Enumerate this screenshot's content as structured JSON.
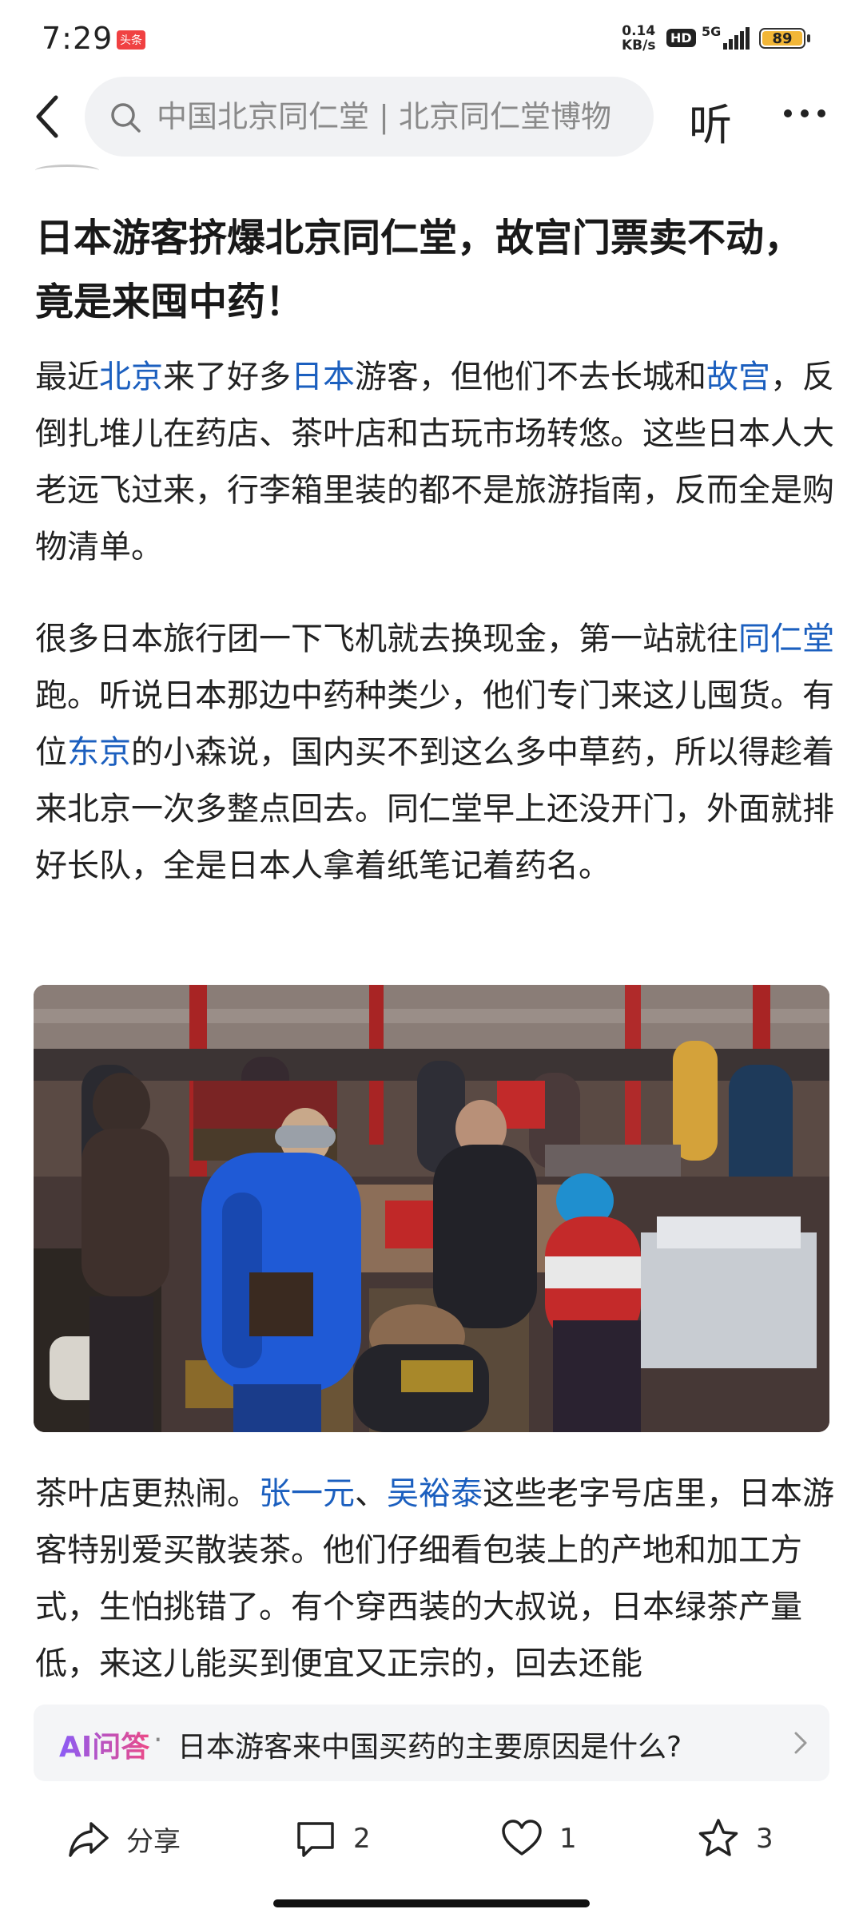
{
  "status_bar": {
    "time": "7:29",
    "news_badge": "头条",
    "net_speed_value": "0.14",
    "net_speed_unit": "KB/s",
    "hd": "HD",
    "network": "5G",
    "battery": "89"
  },
  "top_nav": {
    "search_text": "中国北京同仁堂 | 北京同仁堂博物",
    "listen_label": "听"
  },
  "article": {
    "title": "日本游客挤爆北京同仁堂，故宫门票卖不动，竟是来囤中药！",
    "p1": {
      "s1": "最近",
      "l1": "北京",
      "s2": "来了好多",
      "l2": "日本",
      "s3": "游客，但他们不去长城和",
      "l3": "故宫",
      "s4": "，反倒扎堆儿在药店、茶叶店和古玩市场转悠。这些日本人大老远飞过来，行李箱里装的都不是旅游指南，反而全是购物清单。"
    },
    "p2": {
      "s1": "很多日本旅行团一下飞机就去换现金，第一站就往",
      "l1": "同仁堂",
      "s2": "跑。听说日本那边中药种类少，他们专门来这儿囤货。有位",
      "l2": "东京",
      "s3": "的小森说，国内买不到这么多中草药，所以得趁着来北京一次多整点回去。同仁堂早上还没开门，外面就排好长队，全是日本人拿着纸笔记着药名。"
    },
    "p3": {
      "s1": "茶叶店更热闹。",
      "l1": "张一元",
      "s2": "、",
      "l2": "吴裕泰",
      "s3": "这些老字号店里，日本游客特别爱买散装茶。他们仔细看包装上的产地和加工方式，生怕挑错了。有个穿西装的大叔说，日本绿茶产量低，来这儿能买到便宜又正宗的，回去还能"
    }
  },
  "ai_bar": {
    "label": "AI问答",
    "separator": "·",
    "question": "日本游客来中国买药的主要原因是什么?"
  },
  "actions": {
    "share_label": "分享",
    "comment_count": "2",
    "like_count": "1",
    "favorite_count": "3"
  },
  "colors": {
    "link": "#1b5fbf",
    "ai_gradient_start": "#8a5cf6",
    "ai_gradient_end": "#ec4a87",
    "battery": "#f2b637"
  }
}
